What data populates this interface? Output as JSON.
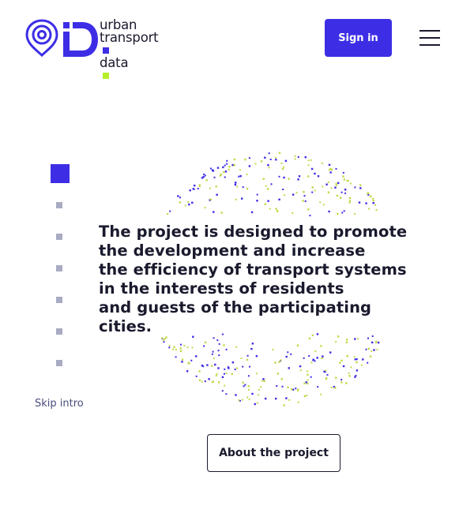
{
  "header": {
    "logo": {
      "line1": "urban",
      "line2": "transport",
      "line3": "data",
      "brand_blue": "#3d2ee6",
      "brand_green": "#b5ef2b"
    },
    "signin_label": "Sign in",
    "menu_icon": "hamburger-menu-icon"
  },
  "intro": {
    "headline_lines": [
      "The project is designed to promote",
      "the development and increase",
      "the efficiency of transport systems",
      "in the interests of residents",
      "and guests of the participating",
      "cities."
    ],
    "skip_label": "Skip intro",
    "steps_total": 7,
    "current_step": 1
  },
  "cta": {
    "about_label": "About the project"
  },
  "colors": {
    "accent": "#3d2ee6",
    "secondary": "#c3d84a",
    "text": "#1a1a2e",
    "inactive_step": "#a9abc3"
  }
}
